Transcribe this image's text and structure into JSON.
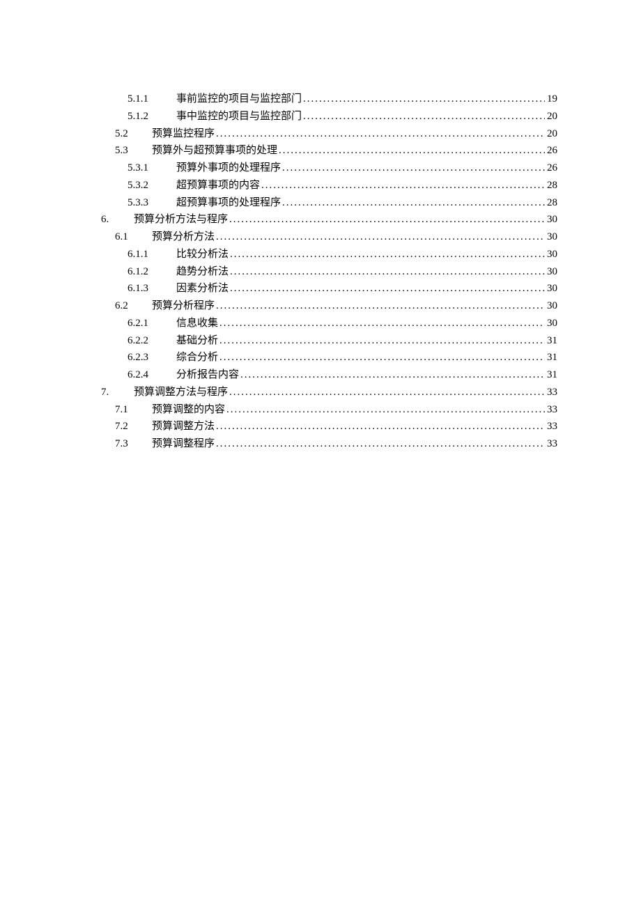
{
  "toc": [
    {
      "level": 3,
      "number": "5.1.1",
      "title": "事前监控的项目与监控部门",
      "page": "19"
    },
    {
      "level": 3,
      "number": "5.1.2",
      "title": "事中监控的项目与监控部门",
      "page": "20"
    },
    {
      "level": 2,
      "number": "5.2",
      "title": "预算监控程序",
      "page": "20"
    },
    {
      "level": 2,
      "number": "5.3",
      "title": "预算外与超预算事项的处理",
      "page": "26"
    },
    {
      "level": 3,
      "number": "5.3.1",
      "title": "预算外事项的处理程序",
      "page": "26"
    },
    {
      "level": 3,
      "number": "5.3.2",
      "title": "超预算事项的内容",
      "page": "28"
    },
    {
      "level": 3,
      "number": "5.3.3",
      "title": "超预算事项的处理程序",
      "page": "28"
    },
    {
      "level": 1,
      "number": "6.",
      "title": "预算分析方法与程序",
      "page": "30"
    },
    {
      "level": 2,
      "number": "6.1",
      "title": "预算分析方法",
      "page": "30"
    },
    {
      "level": 3,
      "number": "6.1.1",
      "title": "比较分析法",
      "page": "30"
    },
    {
      "level": 3,
      "number": "6.1.2",
      "title": "趋势分析法",
      "page": "30"
    },
    {
      "level": 3,
      "number": "6.1.3",
      "title": "因素分析法",
      "page": "30"
    },
    {
      "level": 2,
      "number": "6.2",
      "title": "预算分析程序",
      "page": "30"
    },
    {
      "level": 3,
      "number": "6.2.1",
      "title": "信息收集",
      "page": "30"
    },
    {
      "level": 3,
      "number": "6.2.2",
      "title": "基础分析",
      "page": "31"
    },
    {
      "level": 3,
      "number": "6.2.3",
      "title": "综合分析",
      "page": "31"
    },
    {
      "level": 3,
      "number": "6.2.4",
      "title": "分析报告内容",
      "page": "31"
    },
    {
      "level": 1,
      "number": "7.",
      "title": "预算调整方法与程序",
      "page": "33"
    },
    {
      "level": 2,
      "number": "7.1",
      "title": "预算调整的内容",
      "page": "33"
    },
    {
      "level": 2,
      "number": "7.2",
      "title": "预算调整方法",
      "page": "33"
    },
    {
      "level": 2,
      "number": "7.3",
      "title": "预算调整程序",
      "page": "33"
    }
  ]
}
